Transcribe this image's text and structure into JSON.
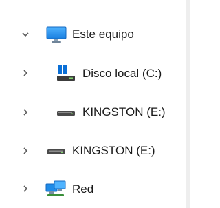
{
  "tree": {
    "items": [
      {
        "label": "Este equipo",
        "icon": "monitor-icon",
        "expanded": true
      },
      {
        "label": "Disco local (C:)",
        "icon": "windows-drive-icon",
        "expanded": false
      },
      {
        "label": "KINGSTON (E:)",
        "icon": "usb-drive-icon",
        "expanded": false
      },
      {
        "label": "KINGSTON (E:)",
        "icon": "usb-drive-icon",
        "expanded": false
      },
      {
        "label": "Red",
        "icon": "network-icon",
        "expanded": false
      }
    ]
  },
  "colors": {
    "text": "#1a1a1a",
    "chevron": "#5a5a5a",
    "monitor_blue": "#1f8be8",
    "windows_blue": "#0a6fd6",
    "drive_gray": "#4a4a4a",
    "drive_light": "#7fd26a"
  }
}
